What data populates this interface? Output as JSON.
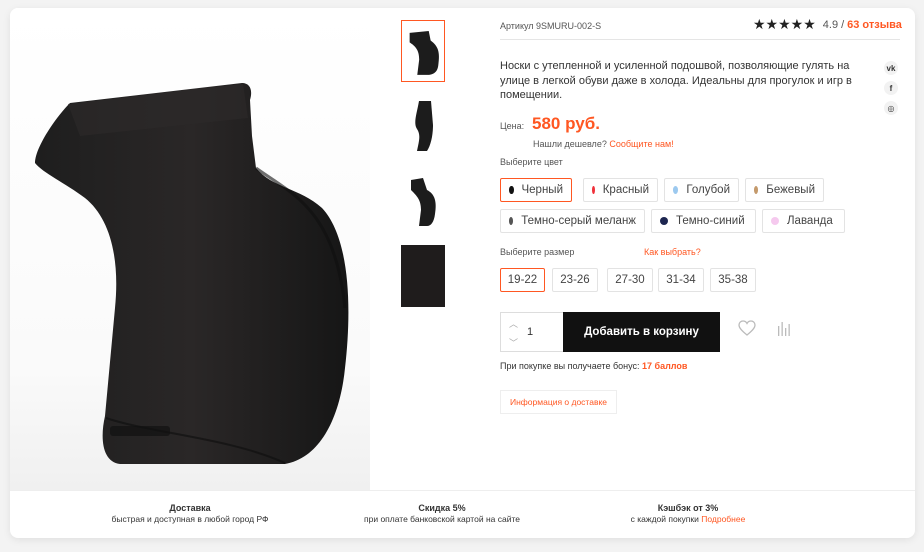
{
  "product": {
    "article": "Артикул 9SMURU-002-S",
    "stars": "★★★★★",
    "rating": "4.9",
    "rating_sep": "/",
    "reviews": "63 отзыва",
    "description": "Носки с утепленной и усиленной подошвой, позволяющие гулять на улице в легкой обуви даже в холода. Идеальны для прогулок и игр в помещении.",
    "price_label": "Цена:",
    "price": "580 руб.",
    "cheaper_text": "Нашли дешевле?",
    "cheaper_link": "Сообщите нам!"
  },
  "social": {
    "vk": "vk",
    "facebook": "f",
    "instagram": "◎"
  },
  "colors": {
    "label": "Выберите цвет",
    "options": [
      {
        "name": "Черный",
        "color": "#111111",
        "selected": true
      },
      {
        "name": "Красный",
        "color": "#f0313a"
      },
      {
        "name": "Голубой",
        "color": "#9cc9ef"
      },
      {
        "name": "Бежевый",
        "color": "#c49a6c"
      },
      {
        "name": "Темно-серый меланж",
        "color": "#555555"
      },
      {
        "name": "Темно-синий",
        "color": "#1d2650"
      },
      {
        "name": "Лаванда",
        "color": "#f5c9ee"
      }
    ]
  },
  "sizes": {
    "label": "Выберите размер",
    "how_link": "Как выбрать?",
    "options": [
      "19-22",
      "23-26",
      "27-30",
      "31-34",
      "35-38"
    ],
    "selected": "19-22"
  },
  "cart": {
    "quantity": "1",
    "up_arrow": "︿",
    "down_arrow": "﹀",
    "add_label": "Добавить в корзину"
  },
  "bonus": {
    "text": "При покупке вы получаете бонус:",
    "value": "17 баллов"
  },
  "delivery_info_label": "Информация о доставке",
  "features": [
    {
      "title": "Доставка",
      "text": "быстрая и доступная в любой город РФ"
    },
    {
      "title": "Скидка 5%",
      "text": "при оплате банковской картой на сайте"
    },
    {
      "title": "Кэшбэк от 3%",
      "text": "с каждой покупки",
      "link": "Подробнее"
    }
  ],
  "accent_color": "#ff5722"
}
